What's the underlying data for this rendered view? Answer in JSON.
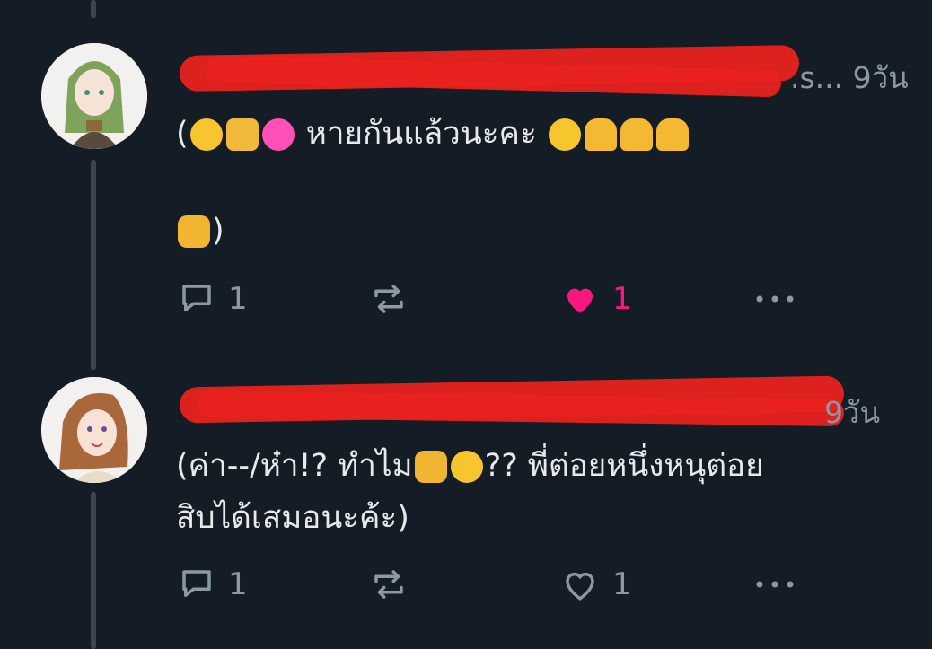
{
  "posts": [
    {
      "time": "9วัน",
      "handle_tail": ".s...",
      "text_line1_a": "(",
      "text_line1_b": "หายกันแล้วนะคะ",
      "text_line2": ")",
      "reply_count": "1",
      "like_count": "1",
      "liked": true
    },
    {
      "time": "9วัน",
      "handle_tail": "...",
      "text_line1": "(ค่า--/ห๋า!? ทำไม",
      "text_line1_b": "?? พี่ต่อยหนึ่งหนุต่อย",
      "text_line2": "สิบได้เสมอนะค้ะ)",
      "reply_count": "1",
      "like_count": "1",
      "liked": false
    }
  ],
  "colors": {
    "background": "#141c26",
    "muted": "#8b98a5",
    "like_active": "#f91880",
    "redaction": "#e8221f"
  },
  "icons": {
    "reply": "reply-icon",
    "retweet": "retweet-icon",
    "like": "heart-icon",
    "more": "more-icon"
  }
}
